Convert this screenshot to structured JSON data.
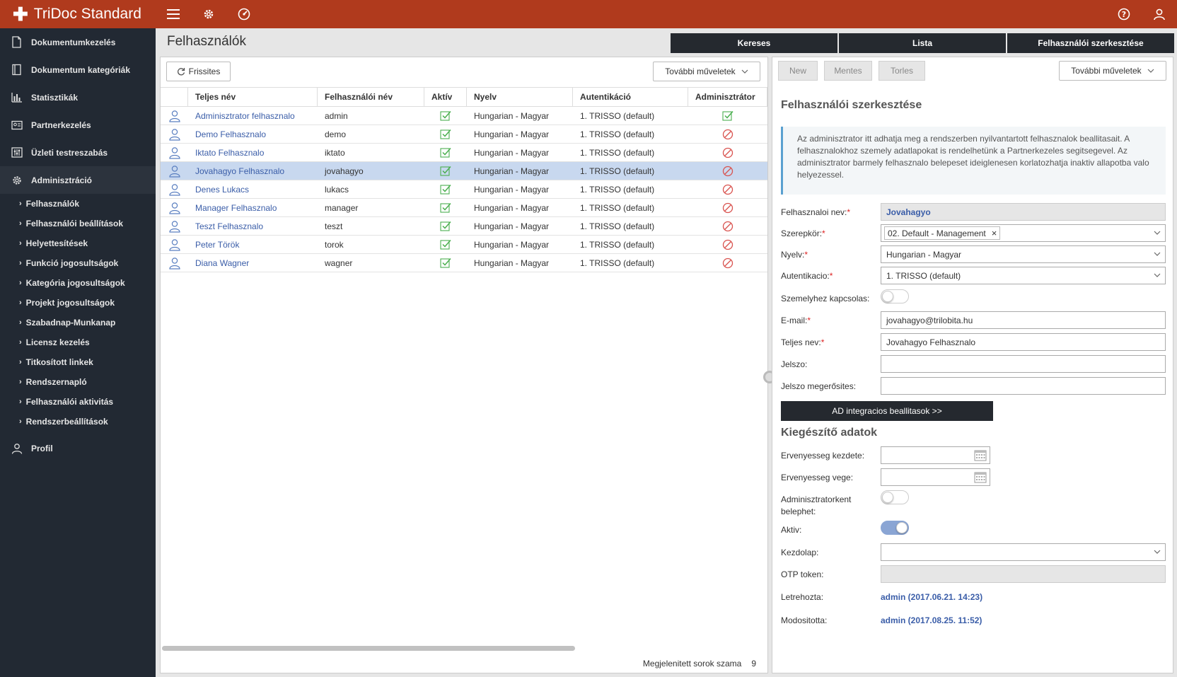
{
  "app": {
    "title": "TriDoc Standard"
  },
  "topbar": {
    "icons": [
      "menu-icon",
      "gear-icon",
      "dashboard-icon",
      "help-icon",
      "user-icon"
    ]
  },
  "sidebar": {
    "main_items": [
      {
        "label": "Dokumentumkezelés",
        "icon": "document-icon"
      },
      {
        "label": "Dokumentum kategóriák",
        "icon": "book-icon"
      },
      {
        "label": "Statisztikák",
        "icon": "bar-chart-icon"
      },
      {
        "label": "Partnerkezelés",
        "icon": "contact-card-icon"
      },
      {
        "label": "Üzleti testreszabás",
        "icon": "sliders-icon"
      },
      {
        "label": "Adminisztráció",
        "icon": "gear-icon"
      }
    ],
    "sub_items": [
      "Felhasználók",
      "Felhasználói beállítások",
      "Helyettesítések",
      "Funkció jogosultságok",
      "Kategória jogosultságok",
      "Projekt jogosultságok",
      "Szabadnap-Munkanap",
      "Licensz kezelés",
      "Titkosított linkek",
      "Rendszernapló",
      "Felhasználói aktivitás",
      "Rendszerbeállítások"
    ],
    "profile_label": "Profil"
  },
  "page": {
    "title": "Felhasználók"
  },
  "view_tabs": [
    "Kereses",
    "Lista",
    "Felhasználói szerkesztése"
  ],
  "list": {
    "refresh_label": "Frissites",
    "more_actions_label": "További műveletek",
    "columns": [
      "Teljes név",
      "Felhasználói név",
      "Aktív",
      "Nyelv",
      "Autentikáció",
      "Adminisztrátor"
    ],
    "rows": [
      {
        "full_name": "Adminisztrator felhasznalo",
        "username": "admin",
        "active": true,
        "language": "Hungarian - Magyar",
        "auth": "1. TRISSO (default)",
        "admin": true
      },
      {
        "full_name": "Demo Felhasznalo",
        "username": "demo",
        "active": true,
        "language": "Hungarian - Magyar",
        "auth": "1. TRISSO (default)",
        "admin": false
      },
      {
        "full_name": "Iktato Felhasznalo",
        "username": "iktato",
        "active": true,
        "language": "Hungarian - Magyar",
        "auth": "1. TRISSO (default)",
        "admin": false
      },
      {
        "full_name": "Jovahagyo Felhasznalo",
        "username": "jovahagyo",
        "active": true,
        "language": "Hungarian - Magyar",
        "auth": "1. TRISSO (default)",
        "admin": false
      },
      {
        "full_name": "Denes Lukacs",
        "username": "lukacs",
        "active": true,
        "language": "Hungarian - Magyar",
        "auth": "1. TRISSO (default)",
        "admin": false
      },
      {
        "full_name": "Manager Felhasznalo",
        "username": "manager",
        "active": true,
        "language": "Hungarian - Magyar",
        "auth": "1. TRISSO (default)",
        "admin": false
      },
      {
        "full_name": "Teszt Felhasznalo",
        "username": "teszt",
        "active": true,
        "language": "Hungarian - Magyar",
        "auth": "1. TRISSO (default)",
        "admin": false
      },
      {
        "full_name": "Peter Török",
        "username": "torok",
        "active": true,
        "language": "Hungarian - Magyar",
        "auth": "1. TRISSO (default)",
        "admin": false
      },
      {
        "full_name": "Diana Wagner",
        "username": "wagner",
        "active": true,
        "language": "Hungarian - Magyar",
        "auth": "1. TRISSO (default)",
        "admin": false
      }
    ],
    "selected_index": 3,
    "row_count_label": "Megjelenitett sorok szama",
    "row_count": "9"
  },
  "editor": {
    "new_label": "New",
    "save_label": "Mentes",
    "delete_label": "Torles",
    "more_actions_label": "További műveletek",
    "title": "Felhasználói szerkesztése",
    "info_text": "Az adminisztrator itt adhatja meg a rendszerben nyilvantartott felhasznalok beallitasait. A felhasznalokhoz szemely adatlapokat is rendelhetünk a Partnerkezeles segitsegevel. Az adminisztrator barmely felhasznalo belepeset ideiglenesen korlatozhatja inaktiv allapotba valo helyezessel.",
    "fields": {
      "username_label": "Felhasznaloi nev:",
      "username_value": "Jovahagyo",
      "role_label": "Szerepkör:",
      "role_value": "02. Default - Management",
      "language_label": "Nyelv:",
      "language_value": "Hungarian - Magyar",
      "auth_label": "Autentikacio:",
      "auth_value": "1. TRISSO (default)",
      "person_link_label": "Szemelyhez kapcsolas:",
      "email_label": "E-mail:",
      "email_value": "jovahagyo@trilobita.hu",
      "fullname_label": "Teljes nev:",
      "fullname_value": "Jovahagyo Felhasznalo",
      "password_label": "Jelszo:",
      "password_confirm_label": "Jelszo megerősites:"
    },
    "ad_button_label": "AD integracios beallitasok >>",
    "extra_title": "Kiegészítő adatok",
    "extra": {
      "valid_from_label": "Ervenyesseg kezdete:",
      "valid_to_label": "Ervenyesseg vege:",
      "admin_login_label_1": "Adminisztratorkent",
      "admin_login_label_2": "belephet:",
      "admin_login_on": false,
      "active_label": "Aktiv:",
      "active_on": true,
      "homepage_label": "Kezdolap:",
      "otp_label": "OTP token:",
      "created_label": "Letrehozta:",
      "created_value": "admin (2017.06.21. 14:23)",
      "modified_label": "Modositotta:",
      "modified_value": "admin (2017.08.25. 11:52)"
    }
  },
  "colors": {
    "topbar": "#b03a1d",
    "sidebar": "#222933",
    "link": "#3a5da8",
    "check": "#4caf50",
    "forbidden": "#d9534f",
    "selected_row": "#c8d8ef"
  }
}
